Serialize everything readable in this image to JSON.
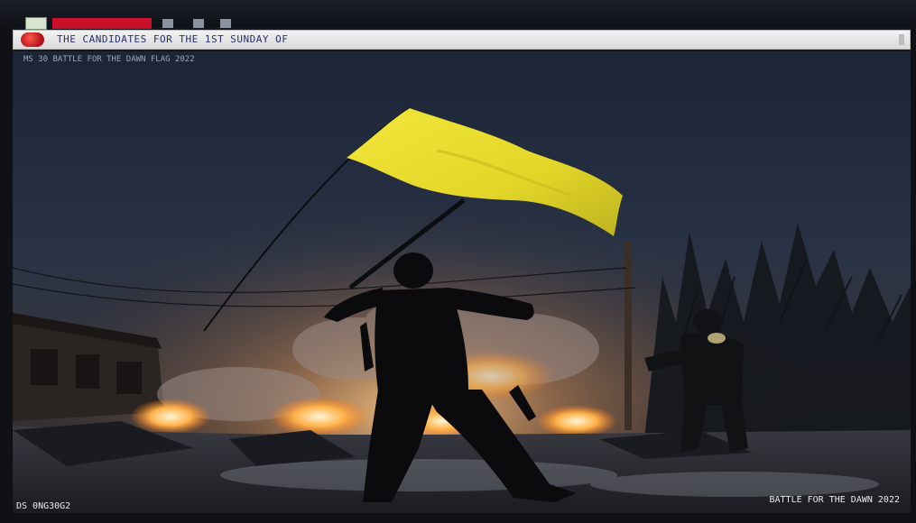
{
  "browser": {
    "address_bar": {
      "url": "THE CANDIDATES FOR THE 1ST SUNDAY OF"
    }
  },
  "photo": {
    "caption_top": "MS 30 BATTLE FOR THE DAWN FLAG 2022",
    "caption_bottom_left": "DS 0NG30G2",
    "caption_bottom_right": "BATTLE FOR THE DAWN 2022",
    "colors": {
      "sky_top": "#1e2a3c",
      "sky_mid": "#2b3447",
      "flag": "#e6dd2a",
      "fire": "#ffd08a",
      "ground": "#2a2c31"
    }
  }
}
